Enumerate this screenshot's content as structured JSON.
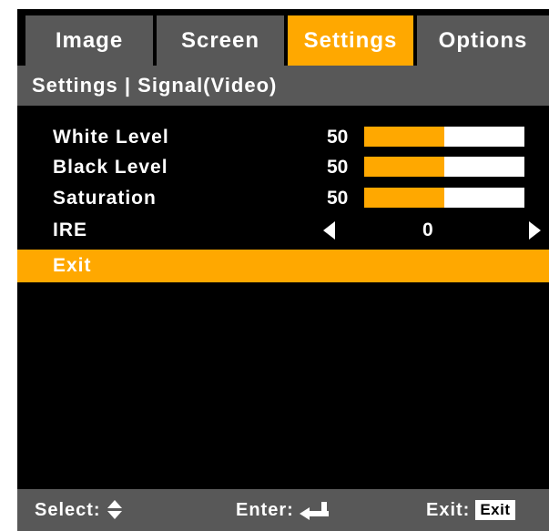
{
  "tabs": [
    {
      "label": "Image",
      "active": false
    },
    {
      "label": "Screen",
      "active": false
    },
    {
      "label": "Settings",
      "active": true
    },
    {
      "label": "Options",
      "active": false
    }
  ],
  "breadcrumb": "Settings | Signal(Video)",
  "settings": {
    "white_level": {
      "label": "White Level",
      "value": "50",
      "fraction": 0.5
    },
    "black_level": {
      "label": "Black Level",
      "value": "50",
      "fraction": 0.5
    },
    "saturation": {
      "label": "Saturation",
      "value": "50",
      "fraction": 0.5
    },
    "ire": {
      "label": "IRE",
      "value": "0"
    },
    "exit": {
      "label": "Exit"
    }
  },
  "footer": {
    "select_label": "Select:",
    "enter_label": "Enter:",
    "exit_label": "Exit:",
    "exit_key": "Exit"
  },
  "colors": {
    "accent": "#ffa800",
    "tab_gray": "#585858",
    "background": "#000000",
    "text": "#ffffff"
  },
  "icons": {
    "select": "up-down-arrows-icon",
    "enter": "enter-return-icon",
    "ire_left": "arrow-left-icon",
    "ire_right": "arrow-right-icon"
  }
}
